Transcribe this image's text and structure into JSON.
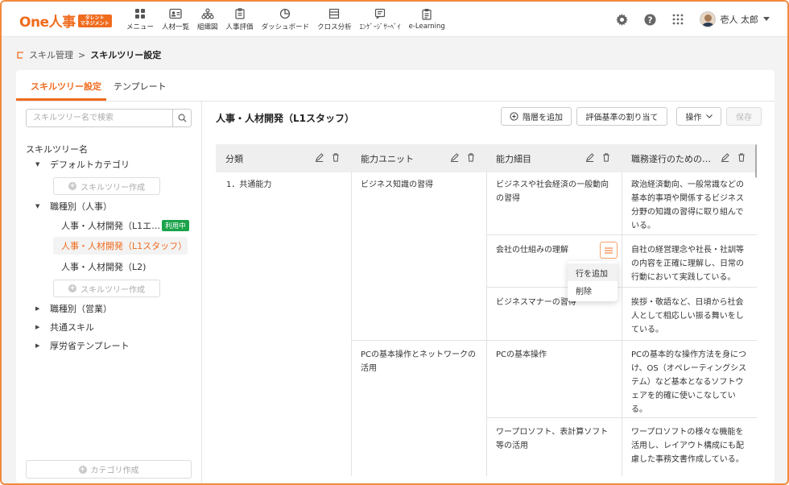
{
  "header": {
    "logo_text": "One人事",
    "logo_badge_line1": "タレント",
    "logo_badge_line2": "マネジメント",
    "nav": [
      {
        "label": "メニュー",
        "icon": "grid-icon"
      },
      {
        "label": "人材一覧",
        "icon": "id-card-icon"
      },
      {
        "label": "組織図",
        "icon": "org-chart-icon"
      },
      {
        "label": "人事評価",
        "icon": "clipboard-icon"
      },
      {
        "label": "ダッシュボード",
        "icon": "pie-chart-icon"
      },
      {
        "label": "クロス分析",
        "icon": "table-icon"
      },
      {
        "label": "ｴﾝｹﾞｰｼﾞｻｰﾍﾞｲ",
        "icon": "survey-icon"
      },
      {
        "label": "e-Learning",
        "icon": "book-icon"
      }
    ],
    "user_name": "壱人 太郎"
  },
  "breadcrumb": {
    "parent": "スキル管理",
    "separator": ">",
    "current": "スキルツリー設定"
  },
  "tabs": [
    {
      "label": "スキルツリー設定",
      "active": true
    },
    {
      "label": "テンプレート",
      "active": false
    }
  ],
  "sidebar": {
    "search_placeholder": "スキルツリー名で検索",
    "tree_title": "スキルツリー名",
    "default_category": "デフォルトカテゴリ",
    "create_tree_label": "スキルツリー作成",
    "job_hr": "職種別（人事）",
    "items": [
      {
        "label": "人事・人材開発（L1エ…",
        "badge": "利用中"
      },
      {
        "label": "人事・人材開発（L1スタッフ）",
        "selected": true
      },
      {
        "label": "人事・人材開発（L2)"
      }
    ],
    "job_sales": "職種別（営業）",
    "common_skills": "共通スキル",
    "mhlw_template": "厚労省テンプレート",
    "create_category_label": "カテゴリ作成"
  },
  "main": {
    "title": "人事・人材開発（L1スタッフ）",
    "add_level_label": "階層を追加",
    "assign_criteria_label": "評価基準の割り当て",
    "operations_label": "操作",
    "save_label": "保存"
  },
  "table": {
    "columns": [
      "分類",
      "能力ユニット",
      "能力細目",
      "職務遂行のための…"
    ],
    "category": "1．共通能力",
    "units": [
      {
        "name": "ビジネス知識の習得",
        "items": [
          {
            "name": "ビジネスや社会経済の一般動向の習得",
            "desc": "政治経済動向、一般常識などの基本的事項や関係するビジネス分野の知識の習得に取り組んでいる。"
          },
          {
            "name": "会社の仕組みの理解",
            "desc": "自社の経営理念や社長・社訓等の内容を正確に理解し、日常の行動において実践している。"
          },
          {
            "name": "ビジネスマナーの習得",
            "desc": "挨拶・敬語など、日頃から社会人として相応しい振る舞いをしている。"
          }
        ]
      },
      {
        "name": "PCの基本操作とネットワークの活用",
        "items": [
          {
            "name": "PCの基本操作",
            "desc": "PCの基本的な操作方法を身につけ、OS（オペレーティングシステム）など基本となるソフトウェアを的確に使いこなしている。"
          },
          {
            "name": "ワープロソフト、表計算ソフト等の活用",
            "desc": "ワープロソフトの様々な機能を活用し、レイアウト構成にも配慮した事務文書作成している。"
          }
        ]
      }
    ],
    "context_menu": [
      "行を追加",
      "削除"
    ]
  },
  "colors": {
    "accent": "#f06b1e",
    "in_use_badge": "#1aa34a"
  }
}
